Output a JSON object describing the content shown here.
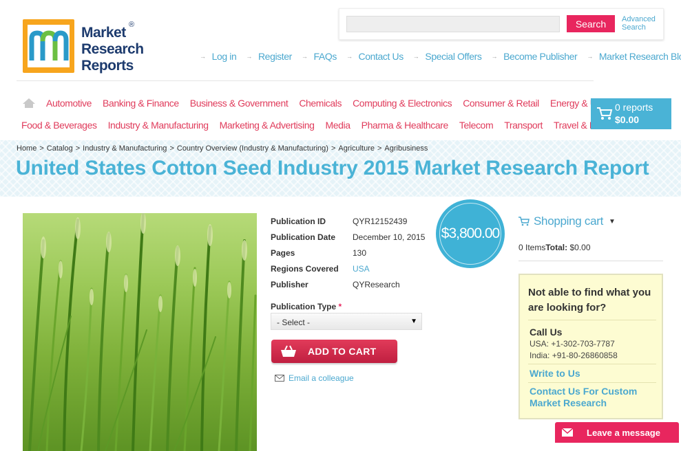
{
  "logo": {
    "line1": "Market",
    "line2": "Research",
    "line3": "Reports",
    "reg": "®"
  },
  "search": {
    "placeholder": "",
    "button": "Search",
    "advanced": "Advanced Search"
  },
  "toplinks": [
    "Log in",
    "Register",
    "FAQs",
    "Contact Us",
    "Special Offers",
    "Become Publisher",
    "Market Research Blog"
  ],
  "categories_row1": [
    "Automotive",
    "Banking & Finance",
    "Business & Government",
    "Chemicals",
    "Computing & Electronics",
    "Consumer & Retail",
    "Energy & Utilities"
  ],
  "categories_row2": [
    "Food & Beverages",
    "Industry & Manufacturing",
    "Marketing & Advertising",
    "Media",
    "Pharma & Healthcare",
    "Telecom",
    "Transport",
    "Travel & Leisure"
  ],
  "cart": {
    "count": "0 reports",
    "total": "$0.00"
  },
  "breadcrumb": [
    "Home",
    "Catalog",
    "Industry & Manufacturing",
    "Country Overview (Industry & Manufacturing)",
    "Agriculture",
    "Agribusiness"
  ],
  "breadcrumb_sep": ">",
  "title": "United States Cotton Seed Industry 2015 Market Research Report",
  "details": {
    "pub_id_label": "Publication ID",
    "pub_id": "QYR12152439",
    "pub_date_label": "Publication Date",
    "pub_date": "December 10, 2015",
    "pages_label": "Pages",
    "pages": "130",
    "regions_label": "Regions Covered",
    "regions": "USA",
    "publisher_label": "Publisher",
    "publisher": "QYResearch"
  },
  "price": "$3,800.00",
  "pub_type": {
    "label": "Publication Type",
    "required": "*",
    "selected": "- Select -"
  },
  "add_to_cart": "ADD TO CART",
  "email_colleague": "Email a colleague",
  "sidebar": {
    "cart_title": "Shopping cart",
    "items": "0 Items",
    "total_label": "Total:",
    "total": "$0.00",
    "help_q": "Not able to find what you are looking for?",
    "call_us": "Call Us",
    "phone_usa": "USA: +1-302-703-7787",
    "phone_india": "India: +91-80-26860858",
    "write": "Write to Us",
    "custom": "Contact Us For Custom Market Research"
  },
  "leave_message": "Leave a message",
  "colors": {
    "accent": "#4ab3d6",
    "pink": "#e8265e",
    "category": "#e03b5b"
  }
}
